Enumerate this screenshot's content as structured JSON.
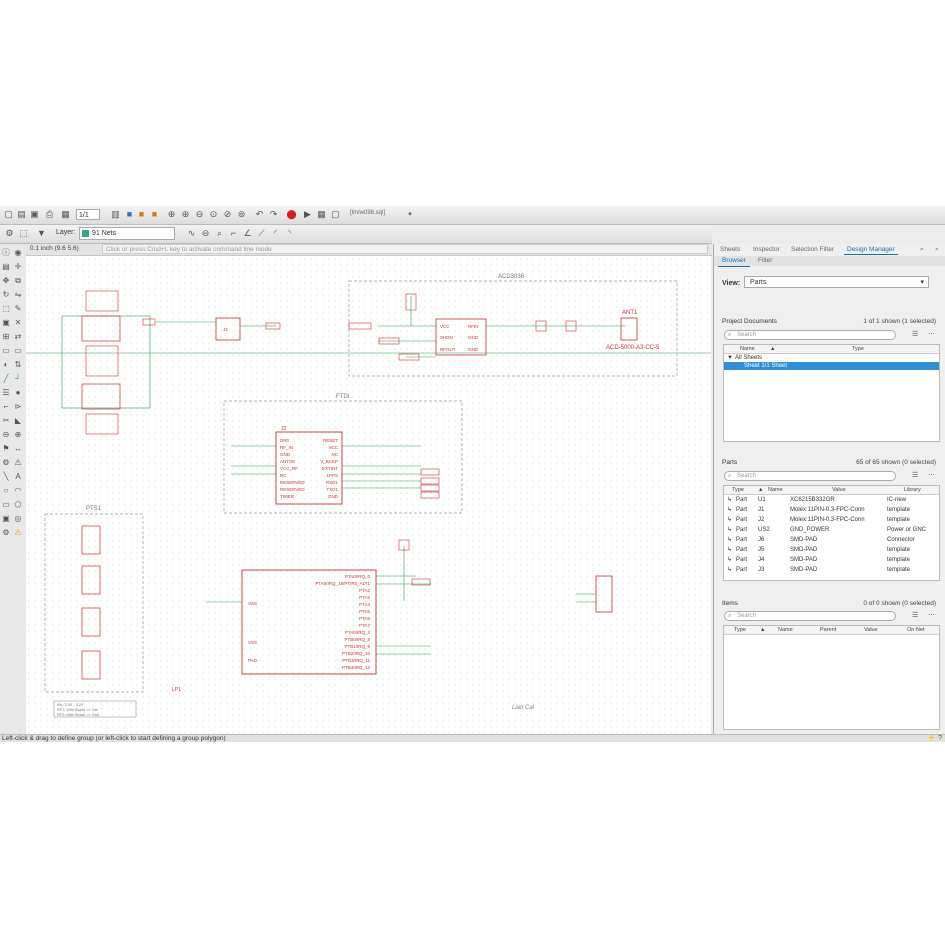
{
  "toolbar": {
    "page_value": "1/1",
    "file_title": "[lm/w098.sql]",
    "layer_label": "Layer:",
    "layer_value": "91 Nets"
  },
  "command_bar": {
    "coordinate": "0.1 inch (9.6 5.6)",
    "hint": "Click or press Cmd+L key to activate command line mode"
  },
  "canvas": {
    "frame_labels": [
      "ACD3036",
      "FTDI",
      "PTS1"
    ],
    "component_labels": [
      "ANT1",
      "ACD-5000-A3-CC-5",
      "J2",
      "UM",
      "U1",
      "VOUT",
      "LP1",
      "Lian Cal"
    ],
    "ic_pins_left": [
      "DR0",
      "RF_IN",
      "GND",
      "ANTOK",
      "VCC_RF",
      "RC",
      "RESERVED",
      "RESERVED",
      "TIMER"
    ],
    "ic_pins_right": [
      "RESET",
      "VCC",
      "NC",
      "V_BCKP",
      "EXTINT",
      "1PPS",
      "RXD1",
      "TXD1",
      "GND"
    ],
    "rf_chip_left": [
      "VCC",
      "SHDN",
      "RFOUT"
    ],
    "rf_chip_right": [
      "RFIN",
      "GND",
      "GND"
    ],
    "mcu_pins_right": [
      "PTA0/IRQ_0",
      "PTA0/IRQ_16/PTIR0_ALT1",
      "PTA2",
      "PTA3",
      "PTA4",
      "PTA5",
      "PTA6",
      "PTA7",
      "PTA0/IRQ_4",
      "PTB0/IRQ_8",
      "PTB1/IRQ_9",
      "PTB2/IRQ_10",
      "PTB3/IRQ_11",
      "PTB4/IRQ_12"
    ],
    "mcu_pins_left": [
      "VSS",
      "VSS",
      "PAD"
    ],
    "note_lines": [
      "Vin: 3.3V - 4.2V",
      "RF1: Wire Board => Cal",
      "RF2: Wire Board => Gnd"
    ]
  },
  "right_panel": {
    "tabs": [
      "Sheets",
      "Inspector",
      "Selection Filter",
      "Design Manager"
    ],
    "subtabs": [
      "Browser",
      "Filter"
    ],
    "view_label": "View:",
    "view_value": "Parts",
    "project_docs": {
      "title": "Project Documents",
      "count": "1 of 1 shown (1 selected)",
      "search_placeholder": "Search",
      "columns": [
        "Name",
        "Type"
      ],
      "rows": [
        {
          "name": "All Sheets",
          "type": ""
        },
        {
          "name": "Sheet 1/1   Sheet",
          "type": ""
        }
      ]
    },
    "parts": {
      "title": "Parts",
      "count": "65 of 65 shown (0 selected)",
      "search_placeholder": "Search",
      "columns": [
        "Type",
        "Name",
        "Value",
        "Library"
      ],
      "rows": [
        {
          "type": "Part",
          "name": "U1",
          "value": "XC6215B332GR",
          "library": "IC-new"
        },
        {
          "type": "Part",
          "name": "J1",
          "value": "Molex:11PIN-0.3-FPC-Conn",
          "library": "template"
        },
        {
          "type": "Part",
          "name": "J2",
          "value": "Molex:11PIN-0.3-FPC-Conn",
          "library": "template"
        },
        {
          "type": "Part",
          "name": "US2",
          "value": "GND_POWER",
          "library": "Power or GNC"
        },
        {
          "type": "Part",
          "name": "J6",
          "value": "SMD-PAD",
          "library": "Connector"
        },
        {
          "type": "Part",
          "name": "J5",
          "value": "SMD-PAD",
          "library": "template"
        },
        {
          "type": "Part",
          "name": "J4",
          "value": "SMD-PAD",
          "library": "template"
        },
        {
          "type": "Part",
          "name": "J3",
          "value": "SMD-PAD",
          "library": "template"
        }
      ]
    },
    "items": {
      "title": "Items",
      "count": "0 of 0 shown (0 selected)",
      "search_placeholder": "Search",
      "columns": [
        "Type",
        "Name",
        "Parent",
        "Value",
        "On Net"
      ]
    }
  },
  "status_bar": {
    "text": "Left-click & drag to define group (or left-click to start defining a group polygon)"
  },
  "colors": {
    "schematic_red": "#cc3333",
    "net_green": "#2a9a58",
    "frame_gray": "#999999",
    "accent_blue": "#1a6fb3",
    "selection_blue": "#2f8ed6"
  }
}
